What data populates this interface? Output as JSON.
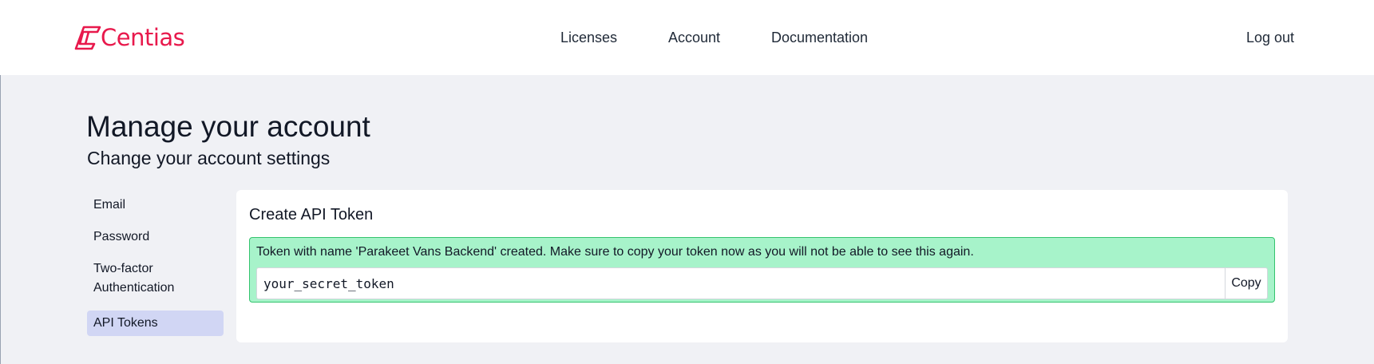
{
  "header": {
    "logo_text": "Centias",
    "nav": {
      "licenses": "Licenses",
      "account": "Account",
      "documentation": "Documentation"
    },
    "logout": "Log out"
  },
  "page": {
    "title": "Manage your account",
    "subtitle": "Change your account settings"
  },
  "sidebar": {
    "items": [
      {
        "label": "Email",
        "active": false
      },
      {
        "label": "Password",
        "active": false
      },
      {
        "label": "Two-factor Authentication",
        "active": false
      },
      {
        "label": "API Tokens",
        "active": true
      }
    ]
  },
  "panel": {
    "title": "Create API Token",
    "alert": {
      "message": "Token with name 'Parakeet Vans Backend' created. Make sure to copy your token now as you will not be able to see this again.",
      "token_value": "your_secret_token",
      "copy_label": "Copy"
    }
  },
  "colors": {
    "brand": "#e8194c",
    "background": "#f0f1f5",
    "active_nav": "#d1d6f4",
    "success_bg": "#a7f3ca",
    "success_border": "#34c46e"
  },
  "icons": {
    "logo": "centias-logo-icon"
  }
}
